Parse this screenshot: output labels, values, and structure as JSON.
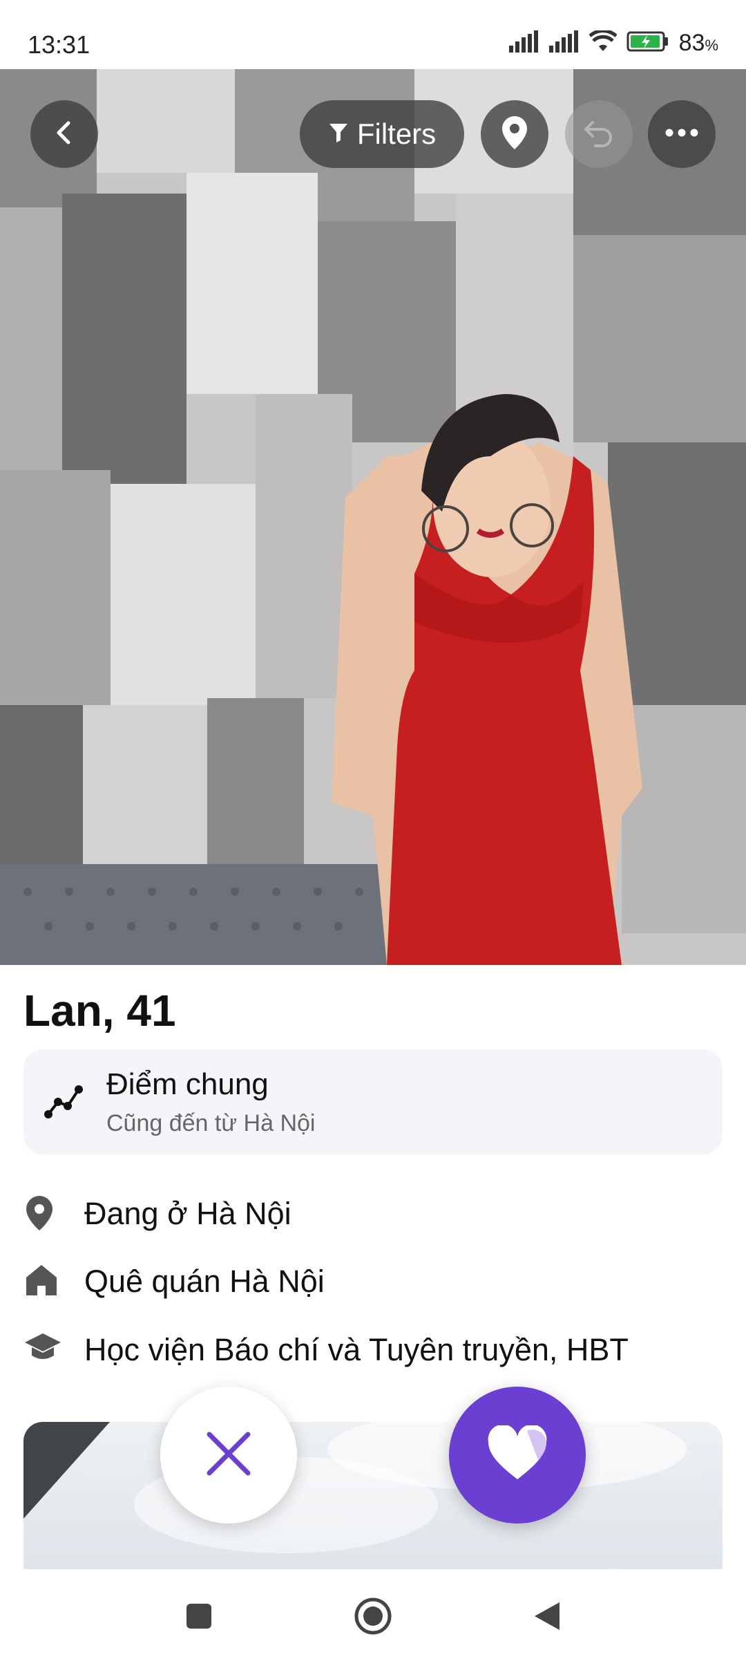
{
  "status_bar": {
    "time": "13:31",
    "battery_percent": "83",
    "battery_unit": "%",
    "signal_icons": [
      "signal-icon",
      "signal-icon",
      "wifi-icon",
      "battery-charging-icon"
    ]
  },
  "top_bar": {
    "back_icon": "chevron-left-icon",
    "filters_label": "Filters",
    "location_icon": "location-pin-icon",
    "undo_icon": "undo-icon",
    "more_icon": "more-horizontal-icon"
  },
  "profile": {
    "name_age": "Lan, 41",
    "common": {
      "title": "Điểm chung",
      "subtitle": "Cũng đến từ Hà Nội"
    },
    "details": [
      {
        "icon": "location-pin-icon",
        "text": "Đang ở Hà Nội"
      },
      {
        "icon": "home-icon",
        "text": "Quê quán Hà Nội"
      },
      {
        "icon": "graduation-cap-icon",
        "text": "Học viện Báo chí và Tuyên truyền, HBT"
      }
    ]
  },
  "actions": {
    "dislike_icon": "close-icon",
    "like_icon": "heart-icon",
    "accent_color": "#6a3fd1"
  },
  "nav_bar": {
    "items": [
      "recent-apps-icon",
      "home-circle-icon",
      "back-triangle-icon"
    ]
  }
}
